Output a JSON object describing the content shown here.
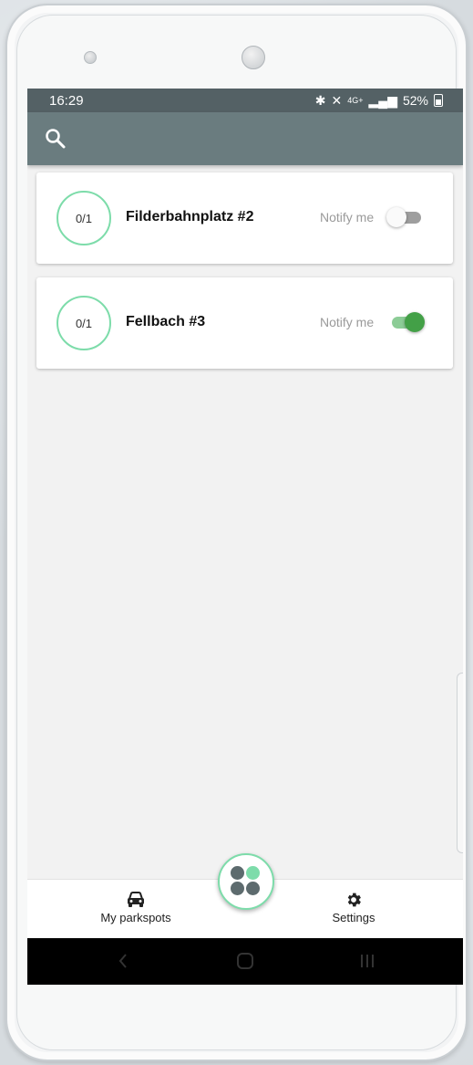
{
  "statusbar": {
    "time": "16:29",
    "network": "4G+",
    "battery_percent": "52%"
  },
  "appbar": {
    "search_icon": "search-icon"
  },
  "parkspots": [
    {
      "occupancy": "0/1",
      "name": "Filderbahnplatz #2",
      "notify_label": "Notify me",
      "notify_on": false
    },
    {
      "occupancy": "0/1",
      "name": "Fellbach #3",
      "notify_label": "Notify me",
      "notify_on": true
    }
  ],
  "bottom_nav": {
    "left_label": "My parkspots",
    "left_icon": "car-icon",
    "right_label": "Settings",
    "right_icon": "gear-icon",
    "center_icon": "grid-dots-icon"
  },
  "colors": {
    "accent": "#7ddcaa",
    "appbar": "#6a7c7f",
    "statusbar": "#546165",
    "toggle_on": "#43a047"
  }
}
